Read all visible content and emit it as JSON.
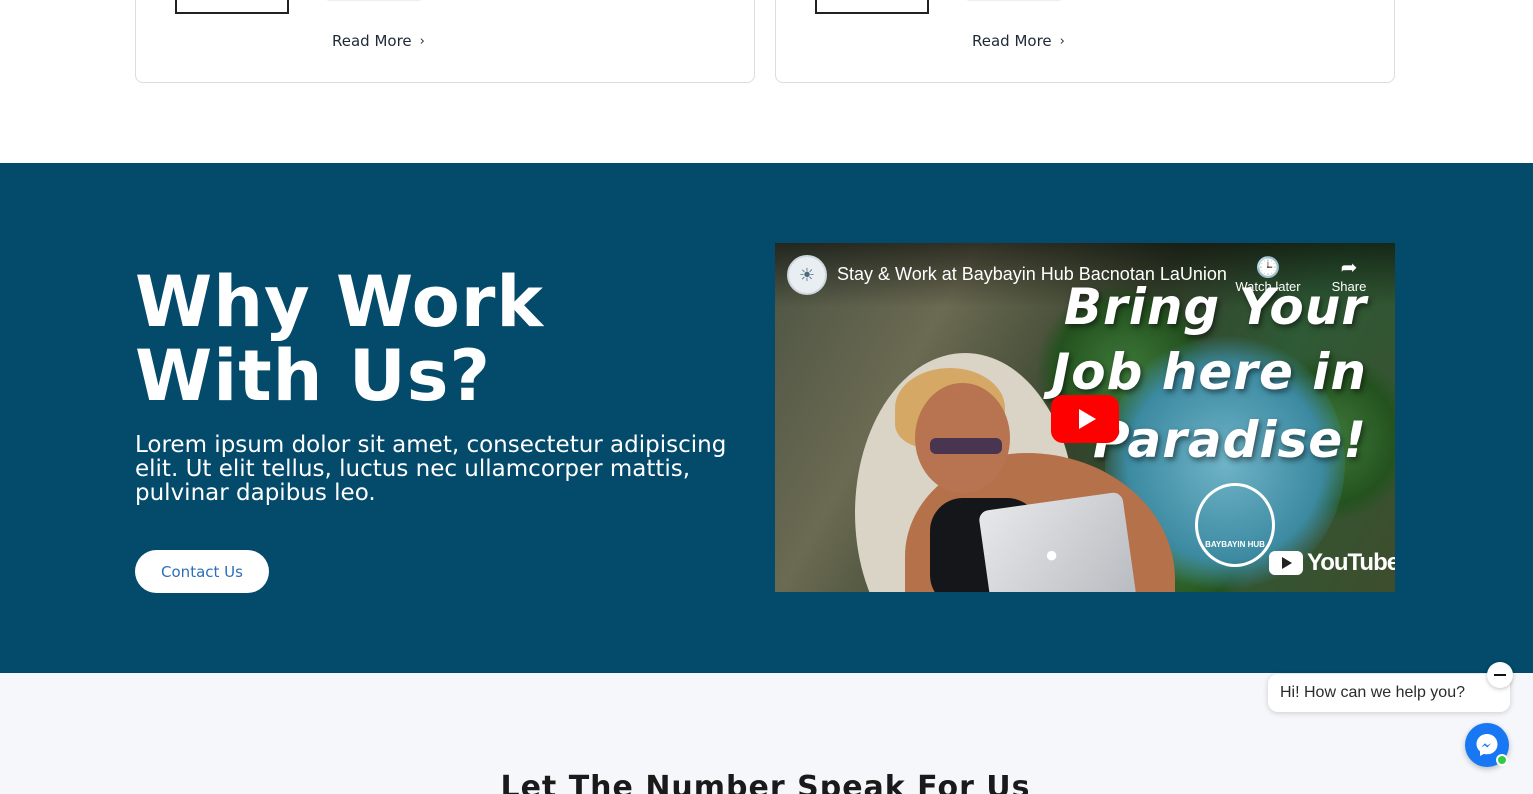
{
  "cards": [
    {
      "read_more": "Read More"
    },
    {
      "read_more": "Read More"
    }
  ],
  "hero": {
    "title_line1": "Why Work",
    "title_line2": "With Us?",
    "text": "Lorem ipsum dolor sit amet, consectetur adipiscing elit. Ut elit tellus, luctus nec ullamcorper mattis, pulvinar dapibus leo.",
    "contact_label": "Contact Us",
    "background": "#034a6b"
  },
  "video": {
    "title": "Stay & Work at Baybayin Hub Bacnotan LaUnion",
    "watch_later": "Watch later",
    "share": "Share",
    "overlay_line1": "Bring Your",
    "overlay_line2": "Job here in",
    "overlay_line3": "Paradise!",
    "brand_name": "BAYBAYIN HUB",
    "platform": "YouTube"
  },
  "numbers": {
    "title": "Let The Number Speak For Us"
  },
  "chat": {
    "greeting": "Hi! How can we help you?"
  }
}
